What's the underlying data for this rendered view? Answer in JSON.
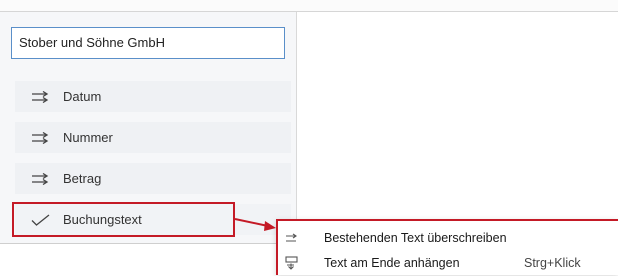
{
  "company_field": {
    "value": "Stober und Söhne GmbH"
  },
  "sort_fields": [
    {
      "label": "Datum",
      "icon": "swap-arrows-icon"
    },
    {
      "label": "Nummer",
      "icon": "swap-arrows-icon"
    },
    {
      "label": "Betrag",
      "icon": "swap-arrows-icon"
    },
    {
      "label": "Buchungstext",
      "icon": "checkmark-icon",
      "selected": true
    }
  ],
  "context_menu": {
    "items": [
      {
        "label": "Bestehenden Text überschreiben",
        "icon": "replace-text-icon",
        "shortcut": ""
      },
      {
        "label": "Text am Ende anhängen",
        "icon": "append-text-icon",
        "shortcut": "Strg+Klick"
      }
    ]
  },
  "colors": {
    "highlight": "#c41a26",
    "field_border": "#5a8fc9",
    "item_bg": "#eff1f4"
  }
}
